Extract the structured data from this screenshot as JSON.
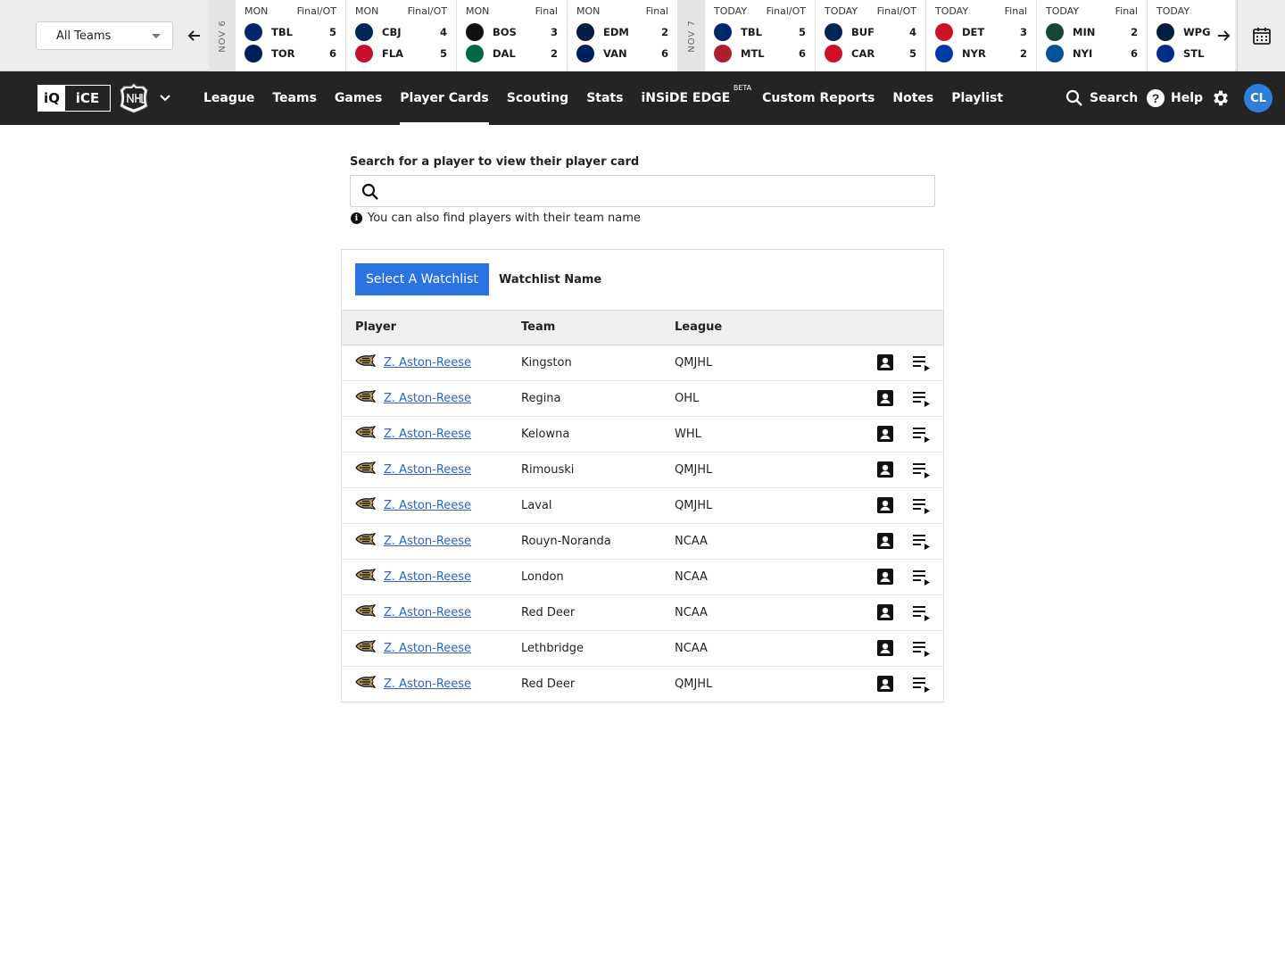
{
  "team_filter": {
    "selected": "All Teams"
  },
  "scoreboard": {
    "date_dividers": [
      "NOV 6",
      "NOV 7"
    ],
    "games_day1": [
      {
        "day": "MON",
        "status": "Final/OT",
        "teams": [
          {
            "abbr": "TBL",
            "score": "5",
            "color": "#002868"
          },
          {
            "abbr": "TOR",
            "score": "6",
            "color": "#00205b"
          }
        ]
      },
      {
        "day": "MON",
        "status": "Final/OT",
        "teams": [
          {
            "abbr": "CBJ",
            "score": "4",
            "color": "#002654"
          },
          {
            "abbr": "FLA",
            "score": "5",
            "color": "#c8102e"
          }
        ]
      },
      {
        "day": "MON",
        "status": "Final",
        "teams": [
          {
            "abbr": "BOS",
            "score": "3",
            "color": "#111111"
          },
          {
            "abbr": "DAL",
            "score": "2",
            "color": "#006847"
          }
        ]
      },
      {
        "day": "MON",
        "status": "Final",
        "teams": [
          {
            "abbr": "EDM",
            "score": "2",
            "color": "#041e42"
          },
          {
            "abbr": "VAN",
            "score": "6",
            "color": "#00205b"
          }
        ]
      }
    ],
    "games_day2": [
      {
        "day": "TODAY",
        "status": "Final/OT",
        "teams": [
          {
            "abbr": "TBL",
            "score": "5",
            "color": "#002868"
          },
          {
            "abbr": "MTL",
            "score": "6",
            "color": "#af1e2d"
          }
        ]
      },
      {
        "day": "TODAY",
        "status": "Final/OT",
        "teams": [
          {
            "abbr": "BUF",
            "score": "4",
            "color": "#002654"
          },
          {
            "abbr": "CAR",
            "score": "5",
            "color": "#ce1126"
          }
        ]
      },
      {
        "day": "TODAY",
        "status": "Final",
        "teams": [
          {
            "abbr": "DET",
            "score": "3",
            "color": "#ce1126"
          },
          {
            "abbr": "NYR",
            "score": "2",
            "color": "#0038a8"
          }
        ]
      },
      {
        "day": "TODAY",
        "status": "Final",
        "teams": [
          {
            "abbr": "MIN",
            "score": "2",
            "color": "#154734"
          },
          {
            "abbr": "NYI",
            "score": "6",
            "color": "#00539b"
          }
        ]
      },
      {
        "day": "TODAY",
        "status": "",
        "teams": [
          {
            "abbr": "WPG",
            "score": "",
            "color": "#041e42"
          },
          {
            "abbr": "STL",
            "score": "",
            "color": "#002f87"
          }
        ]
      }
    ]
  },
  "nav": {
    "brand_left": "iQ",
    "brand_right": "iCE",
    "links": [
      "League",
      "Teams",
      "Games",
      "Player Cards",
      "Scouting",
      "Stats",
      "iNSiDE EDGE",
      "Custom Reports",
      "Notes",
      "Playlist"
    ],
    "beta_badge": "BETA",
    "active_link": "Player Cards",
    "search_label": "Search",
    "help_label": "Help",
    "avatar_initials": "CL"
  },
  "search": {
    "label": "Search for a player to view their player card",
    "value": "",
    "placeholder": "",
    "hint": "You can also find players with their team name"
  },
  "watchlist": {
    "button_label": "Select A Watchlist",
    "name_label": "Watchlist Name",
    "columns": [
      "Player",
      "Team",
      "League"
    ],
    "rows": [
      {
        "player": "Z. Aston-Reese",
        "team": "Kingston",
        "league": "QMJHL"
      },
      {
        "player": "Z. Aston-Reese",
        "team": "Regina",
        "league": "OHL"
      },
      {
        "player": "Z. Aston-Reese",
        "team": "Kelowna",
        "league": "WHL"
      },
      {
        "player": "Z. Aston-Reese",
        "team": "Rimouski",
        "league": "QMJHL"
      },
      {
        "player": "Z. Aston-Reese",
        "team": "Laval",
        "league": "QMJHL"
      },
      {
        "player": "Z. Aston-Reese",
        "team": "Rouyn-Noranda",
        "league": "NCAA"
      },
      {
        "player": "Z. Aston-Reese",
        "team": "London",
        "league": "NCAA"
      },
      {
        "player": "Z. Aston-Reese",
        "team": "Red Deer",
        "league": "NCAA"
      },
      {
        "player": "Z. Aston-Reese",
        "team": "Lethbridge",
        "league": "NCAA"
      },
      {
        "player": "Z. Aston-Reese",
        "team": "Red Deer",
        "league": "QMJHL"
      }
    ]
  }
}
